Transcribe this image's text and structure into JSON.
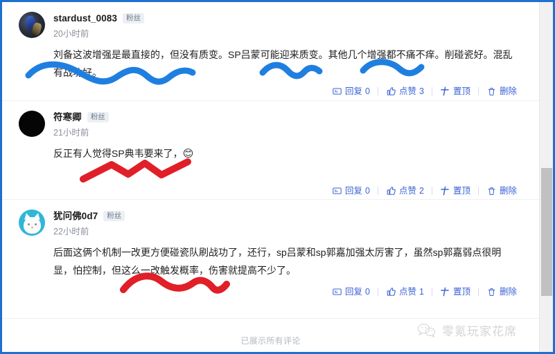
{
  "page": {
    "footer_note": "已展示所有评论",
    "watermark_text": "零氪玩家花席",
    "watermark_icon": "wechat-icon",
    "accent_color": "#3b63d6",
    "frame_border_color": "#1f6fd0",
    "annotation_colors": {
      "blue": "#1f7fe0",
      "red": "#e01f28"
    }
  },
  "action_labels": {
    "reply": "回复",
    "like": "点赞",
    "pin": "置顶",
    "delete": "删除",
    "reply_icon": "comment-icon",
    "like_icon": "thumbs-up-icon",
    "pin_icon": "pin-icon",
    "delete_icon": "trash-icon"
  },
  "comments": [
    {
      "username": "stardust_0083",
      "badge": "粉丝",
      "time": "20小时前",
      "avatar": "game-character-avatar",
      "text": "刘备这波增强是最直接的，但没有质变。SP吕蒙可能迎来质变。其他几个增强都不痛不痒。削碰瓷好。混乱有战功好。",
      "reply_count": "0",
      "like_count": "3"
    },
    {
      "username": "符寒卿",
      "badge": "粉丝",
      "time": "21小时前",
      "avatar": "black-circle-avatar",
      "text": "反正有人觉得SP典韦要来了，",
      "emoji": "😊",
      "reply_count": "0",
      "like_count": "2"
    },
    {
      "username": "犹问佛0d7",
      "badge": "粉丝",
      "time": "22小时前",
      "avatar": "white-cat-avatar",
      "text": "后面这俩个机制一改更方便碰瓷队刷战功了，还行，sp吕蒙和sp郭嘉加强太厉害了，虽然sp郭嘉弱点很明显，怕控制，但这么一改触发概率，伤害就提高不少了。",
      "reply_count": "0",
      "like_count": "1"
    }
  ]
}
